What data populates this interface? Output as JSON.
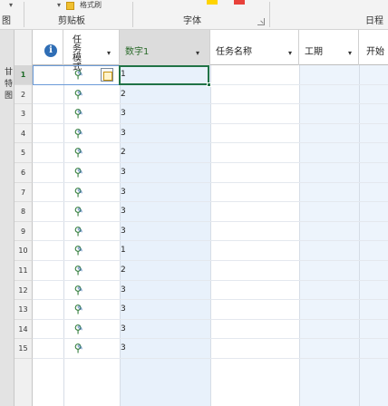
{
  "ribbon": {
    "top_dropdown": "▾",
    "top_dropdown2": "▾",
    "paste_text": "格式刷",
    "left_label": "图",
    "clipboard_label": "剪贴板",
    "font_label": "字体",
    "schedule_label": "日程",
    "font_swatch_colors": [
      "#ffd400",
      "#e8413a"
    ]
  },
  "sidebar": {
    "label": "甘特图"
  },
  "header": {
    "info_icon": "i",
    "mode_title": "任务模式",
    "dropdown_glyph": "▾",
    "col_number1": "数字1",
    "col_task_name": "任务名称",
    "col_duration": "工期",
    "col_start": "开始"
  },
  "rows": [
    {
      "num": "1",
      "value": "1"
    },
    {
      "num": "2",
      "value": "2"
    },
    {
      "num": "3",
      "value": "3"
    },
    {
      "num": "4",
      "value": "3"
    },
    {
      "num": "5",
      "value": "2"
    },
    {
      "num": "6",
      "value": "3"
    },
    {
      "num": "7",
      "value": "3"
    },
    {
      "num": "8",
      "value": "3"
    },
    {
      "num": "9",
      "value": "3"
    },
    {
      "num": "10",
      "value": "1"
    },
    {
      "num": "11",
      "value": "2"
    },
    {
      "num": "12",
      "value": "3"
    },
    {
      "num": "13",
      "value": "3"
    },
    {
      "num": "14",
      "value": "3"
    },
    {
      "num": "15",
      "value": "3"
    }
  ],
  "colors": {
    "accent_green": "#217346",
    "column_tint": "#e8f1fb"
  }
}
